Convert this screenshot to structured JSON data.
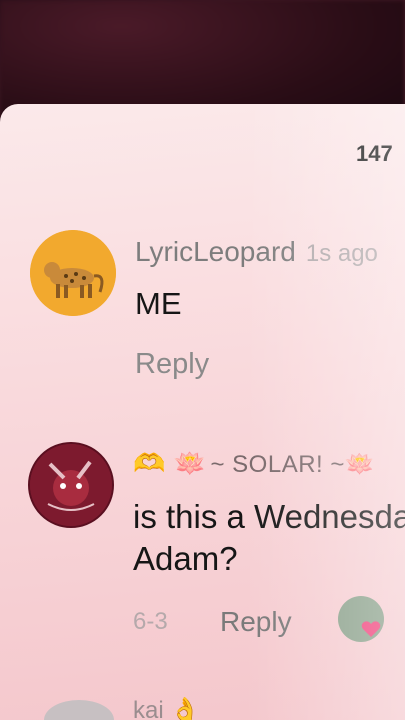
{
  "header": {
    "comment_count": "147"
  },
  "comments": [
    {
      "username": "LyricLeopard",
      "time": "1s ago",
      "text": "ME",
      "reply_label": "Reply"
    },
    {
      "username_emojis": "🫶 🪷",
      "username": "~ SOLAR! ~🪷",
      "text": "is this a Wednesday Adam?",
      "date": "6-3",
      "reply_label": "Reply"
    },
    {
      "username": "kai 👌"
    }
  ],
  "colors": {
    "sheet_bg": "#f9d9dc",
    "text": "#161616",
    "muted": "#8a8a8a"
  }
}
